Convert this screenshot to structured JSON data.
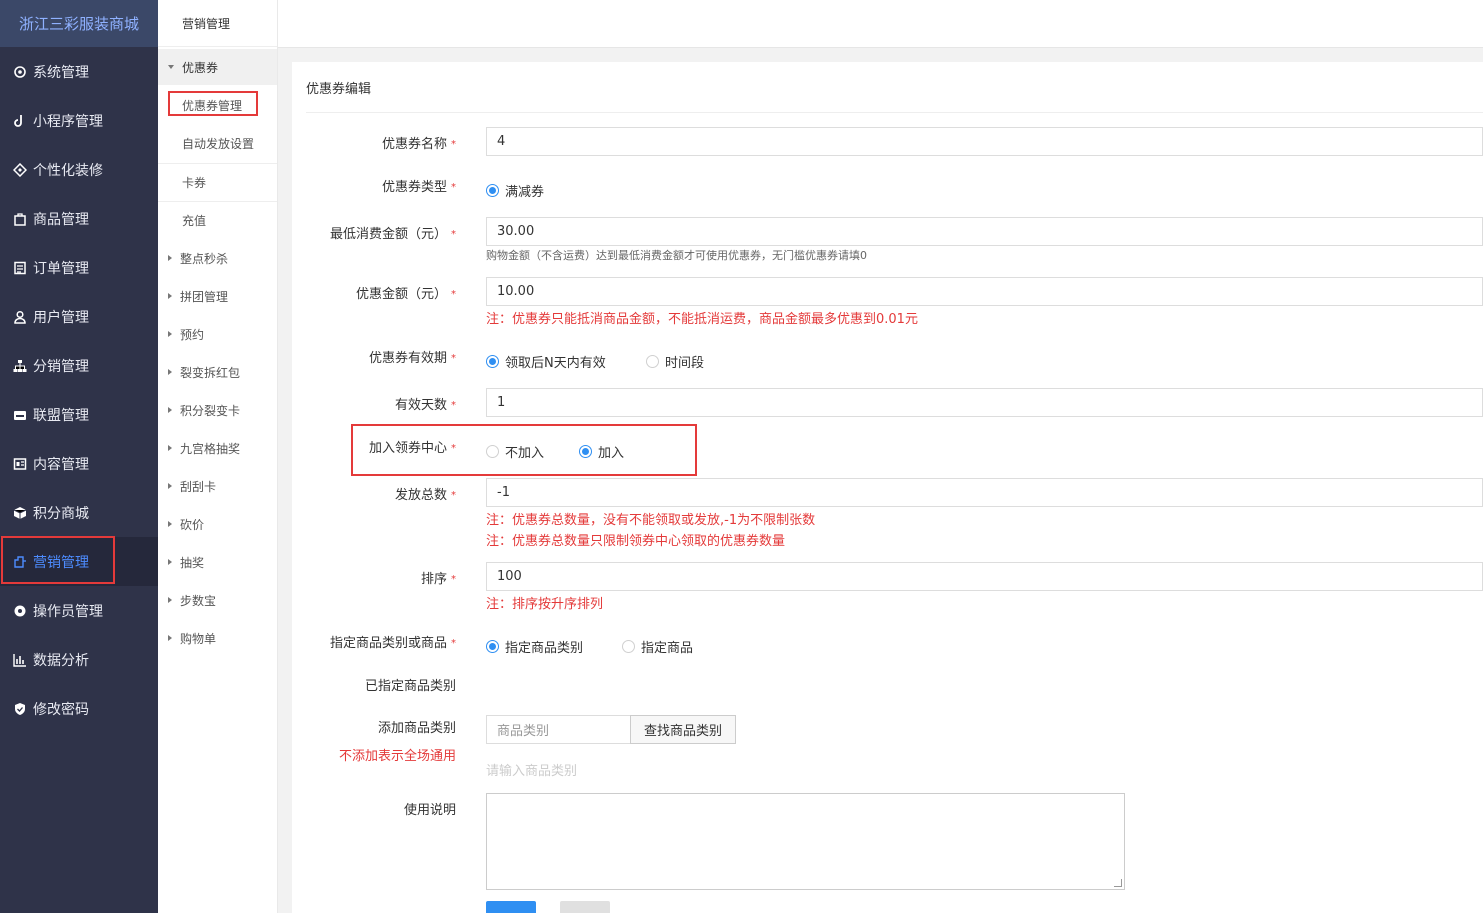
{
  "brand": "浙江三彩服装商城",
  "sidebar": {
    "items": [
      {
        "label": "系统管理",
        "icon": "gear-icon"
      },
      {
        "label": "小程序管理",
        "icon": "tiktok-icon"
      },
      {
        "label": "个性化装修",
        "icon": "palette-icon"
      },
      {
        "label": "商品管理",
        "icon": "bag-icon"
      },
      {
        "label": "订单管理",
        "icon": "list-icon"
      },
      {
        "label": "用户管理",
        "icon": "user-icon"
      },
      {
        "label": "分销管理",
        "icon": "sitemap-icon"
      },
      {
        "label": "联盟管理",
        "icon": "store-icon"
      },
      {
        "label": "内容管理",
        "icon": "content-icon"
      },
      {
        "label": "积分商城",
        "icon": "cube-icon"
      },
      {
        "label": "营销管理",
        "icon": "marketing-icon"
      },
      {
        "label": "操作员管理",
        "icon": "gear-solid-icon"
      },
      {
        "label": "数据分析",
        "icon": "chart-icon"
      },
      {
        "label": "修改密码",
        "icon": "shield-icon"
      }
    ],
    "active": "营销管理"
  },
  "submenu": {
    "head": "营销管理",
    "group": "优惠券",
    "group_items": [
      "优惠券管理",
      "自动发放设置"
    ],
    "items_plain": [
      "卡券",
      "充值"
    ],
    "items_collapsed": [
      "整点秒杀",
      "拼团管理",
      "预约",
      "裂变拆红包",
      "积分裂变卡",
      "九宫格抽奖",
      "刮刮卡",
      "砍价",
      "抽奖",
      "步数宝",
      "购物单"
    ]
  },
  "form": {
    "title": "优惠券编辑",
    "name": {
      "label": "优惠券名称",
      "value": "4"
    },
    "type": {
      "label": "优惠券类型",
      "option": "满减券"
    },
    "min_amount": {
      "label": "最低消费金额（元）",
      "value": "30.00",
      "tip": "购物金额（不含运费）达到最低消费金额才可使用优惠券，无门槛优惠券请填0"
    },
    "discount": {
      "label": "优惠金额（元）",
      "value": "10.00",
      "warn": "注：优惠券只能抵消商品金额，不能抵消运费，商品金额最多优惠到0.01元"
    },
    "validity": {
      "label": "优惠券有效期",
      "opt1": "领取后N天内有效",
      "opt2": "时间段"
    },
    "days": {
      "label": "有效天数",
      "value": "1"
    },
    "center": {
      "label": "加入领券中心",
      "opt1": "不加入",
      "opt2": "加入"
    },
    "total": {
      "label": "发放总数",
      "value": "-1",
      "warn1": "注：优惠券总数量，没有不能领取或发放,-1为不限制张数",
      "warn2": "注：优惠券总数量只限制领券中心领取的优惠券数量"
    },
    "sort": {
      "label": "排序",
      "value": "100",
      "warn": "注：排序按升序排列"
    },
    "scope": {
      "label": "指定商品类别或商品",
      "opt1": "指定商品类别",
      "opt2": "指定商品"
    },
    "assigned": {
      "label": "已指定商品类别"
    },
    "add_cat": {
      "label": "添加商品类别",
      "sub_warn": "不添加表示全场通用",
      "placeholder": "商品类别",
      "button": "查找商品类别",
      "hint": "请输入商品类别"
    },
    "desc": {
      "label": "使用说明"
    }
  },
  "colors": {
    "accent": "#2f8ff2",
    "danger": "#e43a3a",
    "sidebar": "#2f3349"
  }
}
